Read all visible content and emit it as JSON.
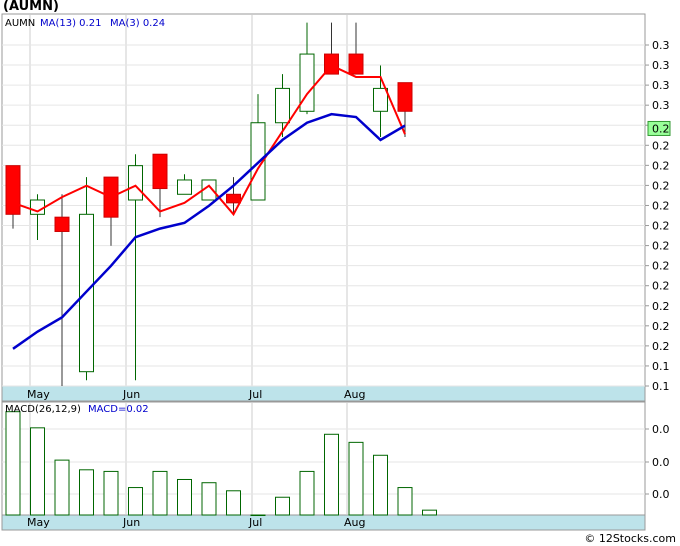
{
  "title": "(AUMN)",
  "footer": "© 12Stocks.com",
  "chart_data": [
    {
      "type": "candlestick",
      "symbol_label": "AUMN",
      "legend": [
        {
          "label": "MA(13)",
          "value": "0.21",
          "color": "#0000cc"
        },
        {
          "label": "MA(3)",
          "value": "0.24",
          "color": "#0000cc"
        }
      ],
      "y_tick_labels": [
        "0.3",
        "0.3",
        "0.3",
        "0.3",
        "0.3",
        "0.2",
        "0.2",
        "0.2",
        "0.2",
        "0.2",
        "0.2",
        "0.2",
        "0.2",
        "0.2",
        "0.2",
        "0.2",
        "0.1",
        "0.1"
      ],
      "ylim": [
        0.142,
        0.272
      ],
      "last_price_label": "0.2",
      "last_price": 0.232,
      "x_tick_labels": [
        "May",
        "Jun",
        "Jul",
        "Aug"
      ],
      "grid": true,
      "colors": {
        "up_body": "#ffffff",
        "up_outline": "#006600",
        "down_body": "#ff0000",
        "ma3": "#ff0000",
        "ma13": "#0000cc",
        "price_tag": "#99ff99",
        "axis_band": "#bde3ea"
      },
      "candles": [
        {
          "open": 0.219,
          "high": 0.219,
          "low": 0.197,
          "close": 0.202
        },
        {
          "open": 0.202,
          "high": 0.209,
          "low": 0.193,
          "close": 0.207
        },
        {
          "open": 0.201,
          "high": 0.209,
          "low": 0.142,
          "close": 0.196
        },
        {
          "open": 0.147,
          "high": 0.215,
          "low": 0.144,
          "close": 0.202
        },
        {
          "open": 0.215,
          "high": 0.215,
          "low": 0.191,
          "close": 0.201
        },
        {
          "open": 0.207,
          "high": 0.223,
          "low": 0.144,
          "close": 0.219
        },
        {
          "open": 0.223,
          "high": 0.223,
          "low": 0.201,
          "close": 0.211
        },
        {
          "open": 0.209,
          "high": 0.216,
          "low": 0.209,
          "close": 0.214
        },
        {
          "open": 0.207,
          "high": 0.214,
          "low": 0.207,
          "close": 0.214
        },
        {
          "open": 0.209,
          "high": 0.215,
          "low": 0.202,
          "close": 0.206
        },
        {
          "open": 0.207,
          "high": 0.244,
          "low": 0.207,
          "close": 0.234
        },
        {
          "open": 0.234,
          "high": 0.251,
          "low": 0.229,
          "close": 0.246
        },
        {
          "open": 0.238,
          "high": 0.269,
          "low": 0.237,
          "close": 0.258
        },
        {
          "open": 0.258,
          "high": 0.269,
          "low": 0.251,
          "close": 0.251
        },
        {
          "open": 0.258,
          "high": 0.269,
          "low": 0.251,
          "close": 0.251
        },
        {
          "open": 0.238,
          "high": 0.254,
          "low": 0.229,
          "close": 0.246
        },
        {
          "open": 0.248,
          "high": 0.248,
          "low": 0.229,
          "close": 0.238
        }
      ],
      "ma3": [
        0.206,
        0.203,
        0.208,
        0.212,
        0.208,
        0.212,
        0.203,
        0.206,
        0.212,
        0.202,
        0.218,
        0.231,
        0.244,
        0.254,
        0.25,
        0.25,
        0.23
      ],
      "ma13": [
        0.155,
        0.161,
        0.166,
        0.175,
        0.184,
        0.194,
        0.197,
        0.199,
        0.205,
        0.212,
        0.22,
        0.228,
        0.234,
        0.237,
        0.236,
        0.228,
        0.233
      ]
    },
    {
      "type": "bar",
      "label": "MACD(26,12,9)",
      "legend_value_label": "MACD",
      "legend_value": "0.02",
      "y_tick_labels": [
        "0.0",
        "0.0",
        "0.0"
      ],
      "ylim": [
        0,
        0.035
      ],
      "values": [
        0.032,
        0.027,
        0.017,
        0.014,
        0.0135,
        0.0085,
        0.0135,
        0.011,
        0.01,
        0.0075,
        0.0,
        0.0055,
        0.0135,
        0.025,
        0.0225,
        0.0185,
        0.0085,
        0.0015
      ],
      "colors": {
        "bar_outline": "#006600",
        "bar_fill": "#ffffff"
      }
    }
  ]
}
